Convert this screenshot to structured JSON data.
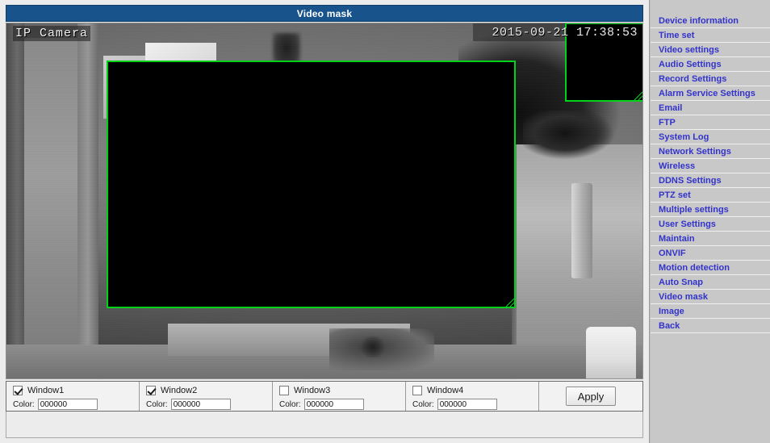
{
  "window": {
    "title": "Video mask"
  },
  "video": {
    "osd_label": "IP Camera",
    "osd_date": "2015-09-21",
    "osd_time": "17:38:53",
    "mask_border_color": "#00d21a",
    "mask_fill_color": "#000000"
  },
  "controls": {
    "windows": [
      {
        "name": "window1",
        "label": "Window1",
        "checked": true,
        "color_label": "Color:",
        "color_value": "000000"
      },
      {
        "name": "window2",
        "label": "Window2",
        "checked": true,
        "color_label": "Color:",
        "color_value": "000000"
      },
      {
        "name": "window3",
        "label": "Window3",
        "checked": false,
        "color_label": "Color:",
        "color_value": "000000"
      },
      {
        "name": "window4",
        "label": "Window4",
        "checked": false,
        "color_label": "Color:",
        "color_value": "000000"
      }
    ],
    "apply_label": "Apply"
  },
  "sidebar": {
    "items": [
      {
        "label": "Device information"
      },
      {
        "label": "Time set"
      },
      {
        "label": "Video settings"
      },
      {
        "label": "Audio Settings"
      },
      {
        "label": "Record Settings"
      },
      {
        "label": "Alarm Service Settings"
      },
      {
        "label": "Email"
      },
      {
        "label": "FTP"
      },
      {
        "label": "System Log"
      },
      {
        "label": "Network Settings"
      },
      {
        "label": "Wireless"
      },
      {
        "label": "DDNS Settings"
      },
      {
        "label": "PTZ set"
      },
      {
        "label": "Multiple settings"
      },
      {
        "label": "User Settings"
      },
      {
        "label": "Maintain"
      },
      {
        "label": "ONVIF"
      },
      {
        "label": "Motion detection"
      },
      {
        "label": "Auto Snap"
      },
      {
        "label": "Video mask"
      },
      {
        "label": "Image"
      },
      {
        "label": "Back"
      }
    ],
    "link_color": "#3333cc"
  },
  "theme": {
    "titlebar_color": "#18538c",
    "panel_bg": "#ececec",
    "sidebar_bg": "#c8c8c8"
  }
}
